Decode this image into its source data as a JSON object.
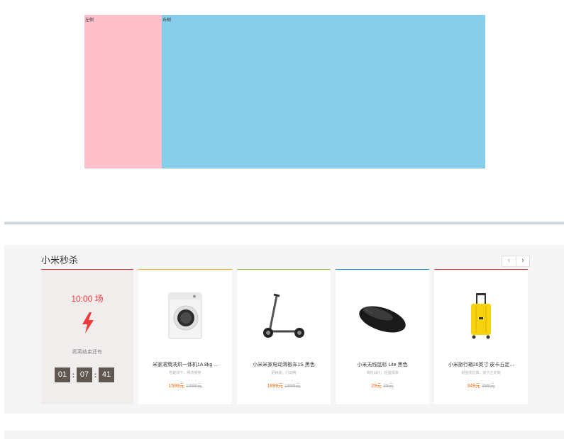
{
  "demo": {
    "left_label": "左侧",
    "right_label": "右侧"
  },
  "flash_sale": {
    "title": "小米秒杀",
    "pager": {
      "prev": "‹",
      "next": "›"
    },
    "session": "10:00 场",
    "countdown_label": "距离结束还有",
    "countdown": {
      "hours": "01",
      "minutes": "07",
      "seconds": "41"
    },
    "products": [
      {
        "name": "米家滚筒洗烘一体机1A 8kg ...",
        "desc": "智能烘干，哪洗哪穿",
        "price": "1599元",
        "old_price": "1999元",
        "accent": "#ffac13",
        "icon": "washing-machine-icon"
      },
      {
        "name": "小米米家电动滑板车1S 黑色",
        "desc": "更续航，行动畅",
        "price": "1899元",
        "old_price": "1999元",
        "accent": "#83c44e",
        "icon": "scooter-icon"
      },
      {
        "name": "小米无线鼠标 Lite 黑色",
        "desc": "简约设计，轻盈顺滑",
        "price": "29元",
        "old_price": "39元",
        "accent": "#2196f3",
        "icon": "mouse-icon"
      },
      {
        "name": "小米旅行箱20英寸 皮卡丘定...",
        "desc": "耐刮花抗摔，皮卡丘定制",
        "price": "349元",
        "old_price": "399元",
        "accent": "#e53935",
        "icon": "suitcase-icon"
      }
    ]
  },
  "colors": {
    "session_red": "#ef3a3b",
    "price_orange": "#ff6700",
    "timer_dark": "#605751"
  }
}
